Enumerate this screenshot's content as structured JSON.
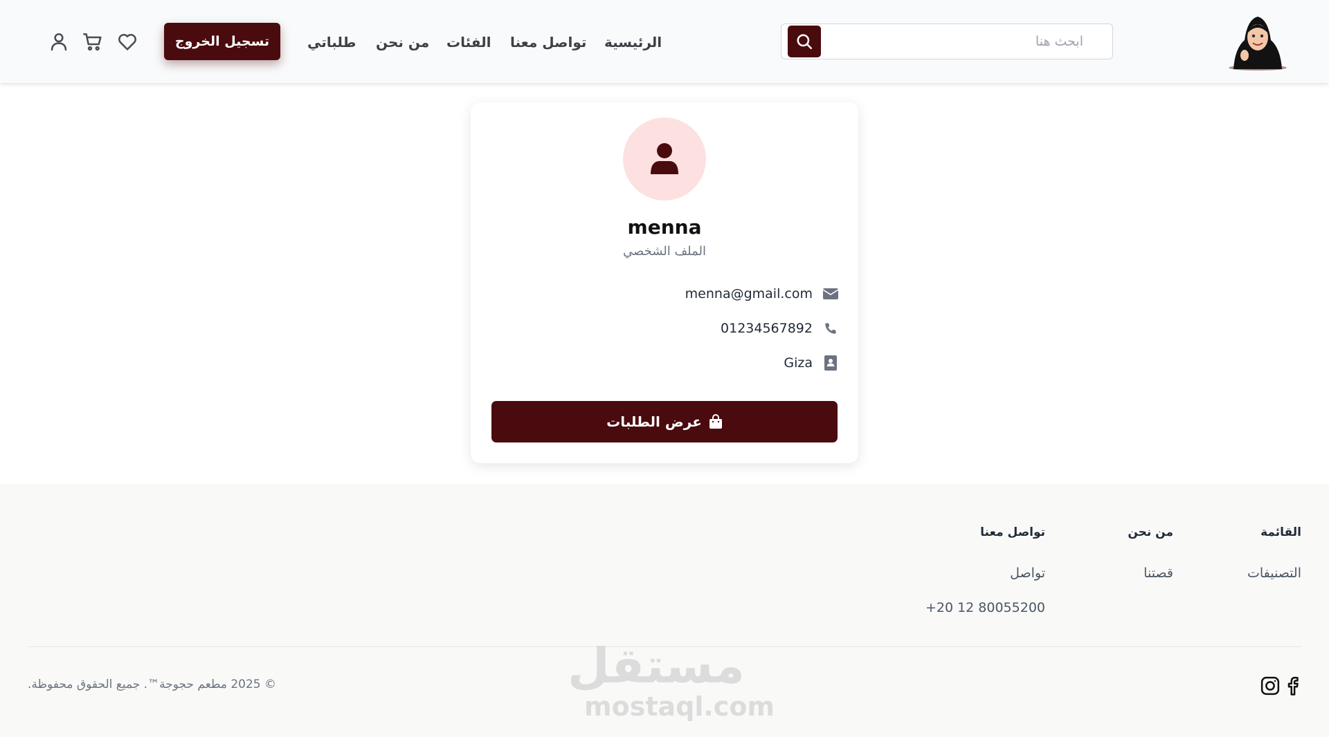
{
  "header": {
    "search": {
      "placeholder": "ابحث هنا"
    },
    "nav": {
      "home": "الرئيسية",
      "contact": "تواصل معنا",
      "categories": "الفئات",
      "about": "من نحن",
      "my_orders": "طلباتي"
    },
    "logout_label": "تسجيل الخروج"
  },
  "profile": {
    "name": "menna",
    "subtitle": "الملف الشخصي",
    "email": "menna@gmail.com",
    "phone": "01234567892",
    "address": "Giza",
    "orders_button": "عرض الطلبات"
  },
  "footer": {
    "menu": {
      "heading": "القائمة",
      "links": [
        "التصنيفات"
      ]
    },
    "about": {
      "heading": "من نحن",
      "links": [
        "قصتنا"
      ]
    },
    "contact": {
      "heading": "تواصل معنا",
      "links": [
        "تواصل",
        "+20 12 80055200"
      ]
    },
    "copyright": "© 2025 مطعم حجوجة™. جميع الحقوق محفوظة.",
    "watermark": {
      "arabic": "مستقل",
      "latin": "mostaql.com"
    }
  },
  "colors": {
    "brand": "#4a0b0e",
    "avatar_bg": "#fde1e1",
    "header_bg": "#f9fafb",
    "footer_bg": "#f9f9f8"
  },
  "icons": {
    "header": [
      "search-icon",
      "heart-icon",
      "cart-icon",
      "user-icon"
    ],
    "profile": [
      "user-silhouette-icon",
      "envelope-icon",
      "phone-icon",
      "address-card-icon",
      "shopping-bag-icon"
    ],
    "footer": [
      "instagram-icon",
      "facebook-icon"
    ]
  }
}
